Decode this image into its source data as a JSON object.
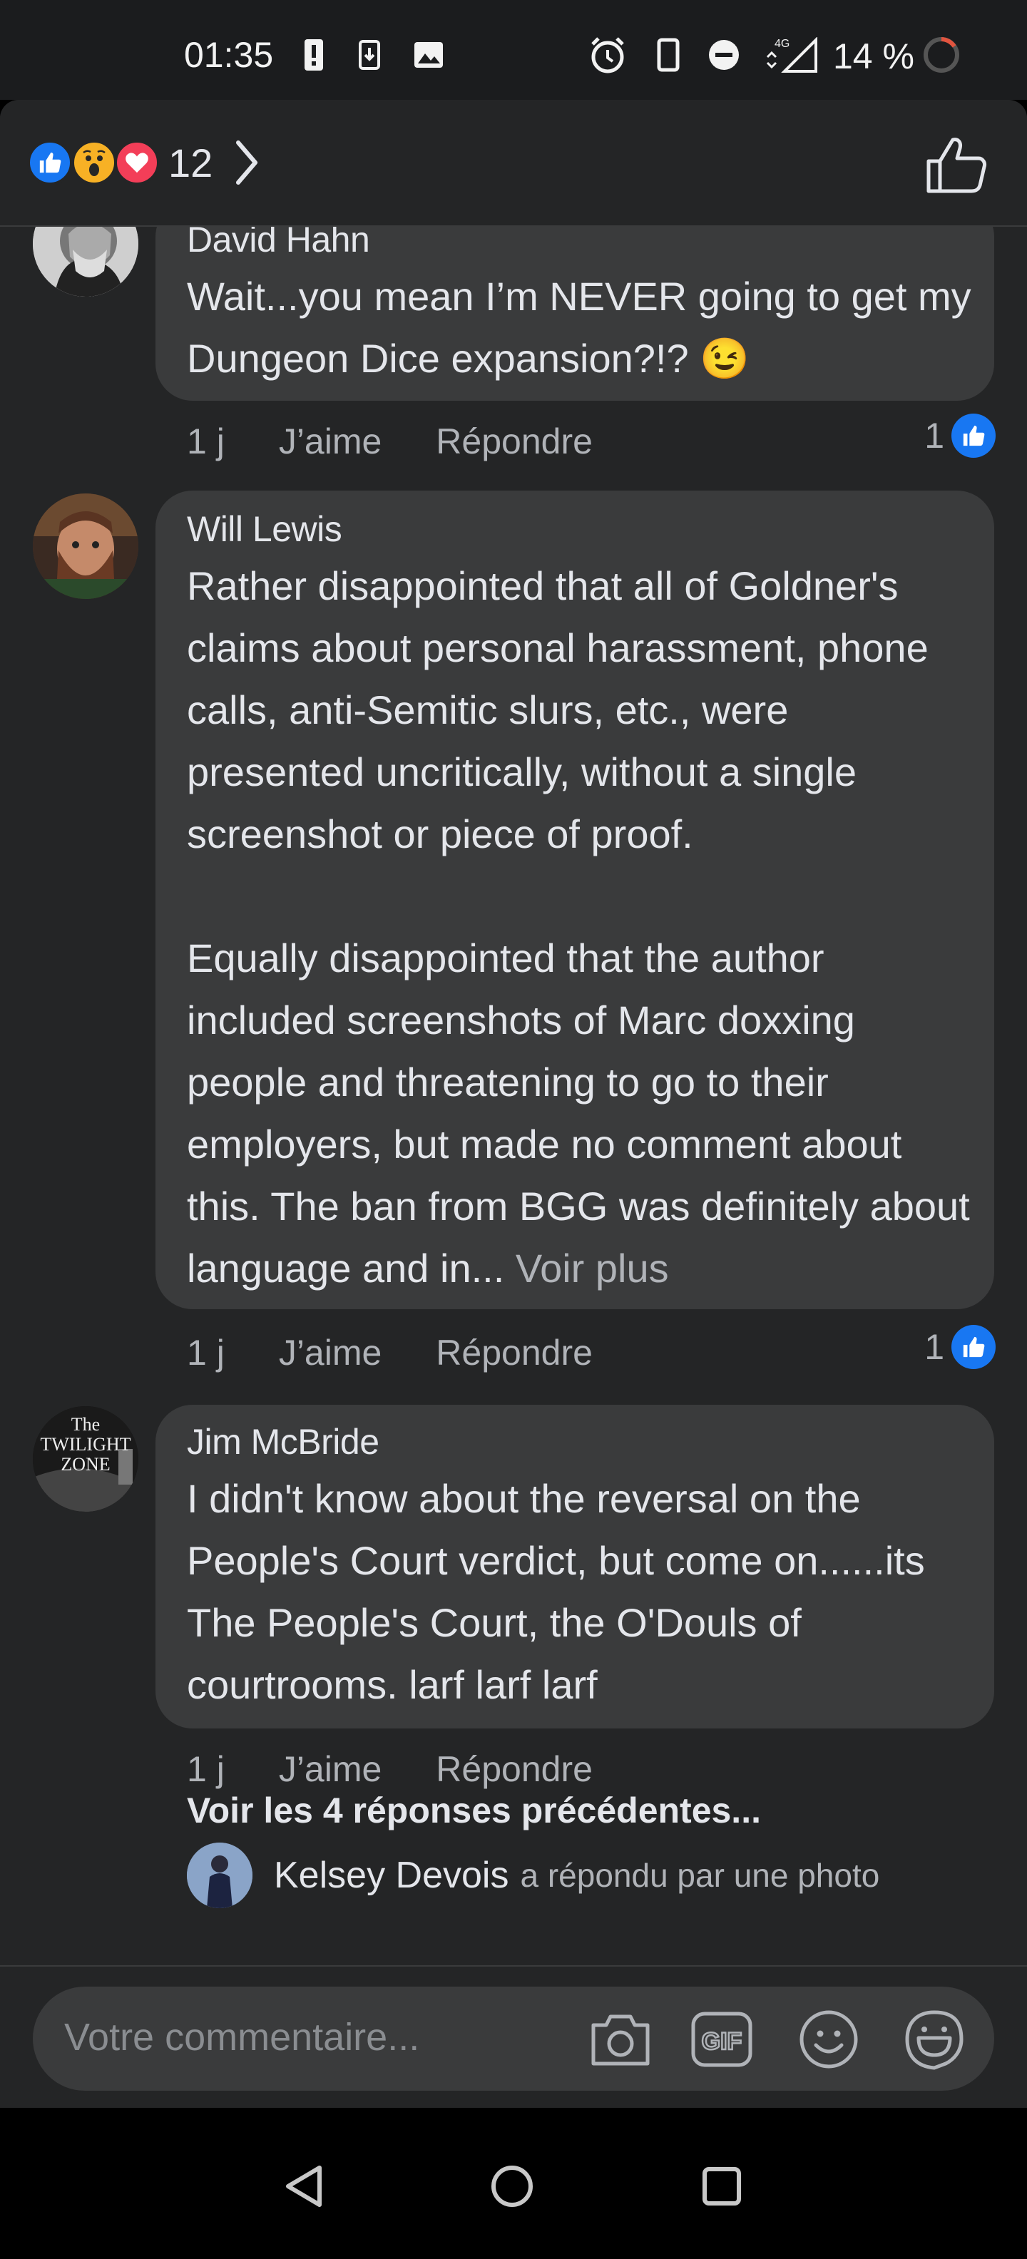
{
  "status_bar": {
    "time": "01:35",
    "network": "4G",
    "battery": "14 %",
    "icons": [
      "alert-icon",
      "download-icon",
      "image-icon",
      "alarm-icon",
      "phone-icon",
      "dnd-icon",
      "signal-icon",
      "battery-ring-icon"
    ]
  },
  "reactions": {
    "icons": [
      "like-reaction-icon",
      "wow-reaction-icon",
      "love-reaction-icon"
    ],
    "count": "12"
  },
  "comments": [
    {
      "author": "David Hahn",
      "text": "Wait...you mean I’m NEVER going to get my Dungeon Dice expansion?!? 😉",
      "time": "1 j",
      "like_label": "J’aime",
      "reply_label": "Répondre",
      "like_count": "1"
    },
    {
      "author": "Will Lewis",
      "text": "Rather disappointed that all of Goldner's claims about personal harassment, phone calls, anti-Semitic slurs, etc., were presented uncritically, without a single screenshot or piece of proof.\n\nEqually disappointed that the author included screenshots of Marc doxxing people and threatening to go to their employers, but made no comment about this. The ban from BGG was definitely about language and in... ",
      "see_more": "Voir plus",
      "time": "1 j",
      "like_label": "J’aime",
      "reply_label": "Répondre",
      "like_count": "1"
    },
    {
      "author": "Jim McBride",
      "text": "I didn't know about the reversal on the People's Court verdict, but come on......its The People's Court, the O'Douls of courtrooms. larf larf larf",
      "time": "1 j",
      "like_label": "J’aime",
      "reply_label": "Répondre",
      "avatar_text": [
        "The",
        "TWILIGHT",
        "ZONE"
      ]
    }
  ],
  "previous_replies": "Voir les 4 réponses précédentes...",
  "reply_preview": {
    "name": "Kelsey Devois",
    "text": "a répondu par une photo"
  },
  "composer": {
    "placeholder": "Votre commentaire...",
    "gif_label": "GIF"
  },
  "colors": {
    "background": "#242526",
    "bubble": "#3a3b3c",
    "like_blue": "#1877f2",
    "love_red": "#f33e58",
    "secondary_text": "#b0b3b8"
  }
}
